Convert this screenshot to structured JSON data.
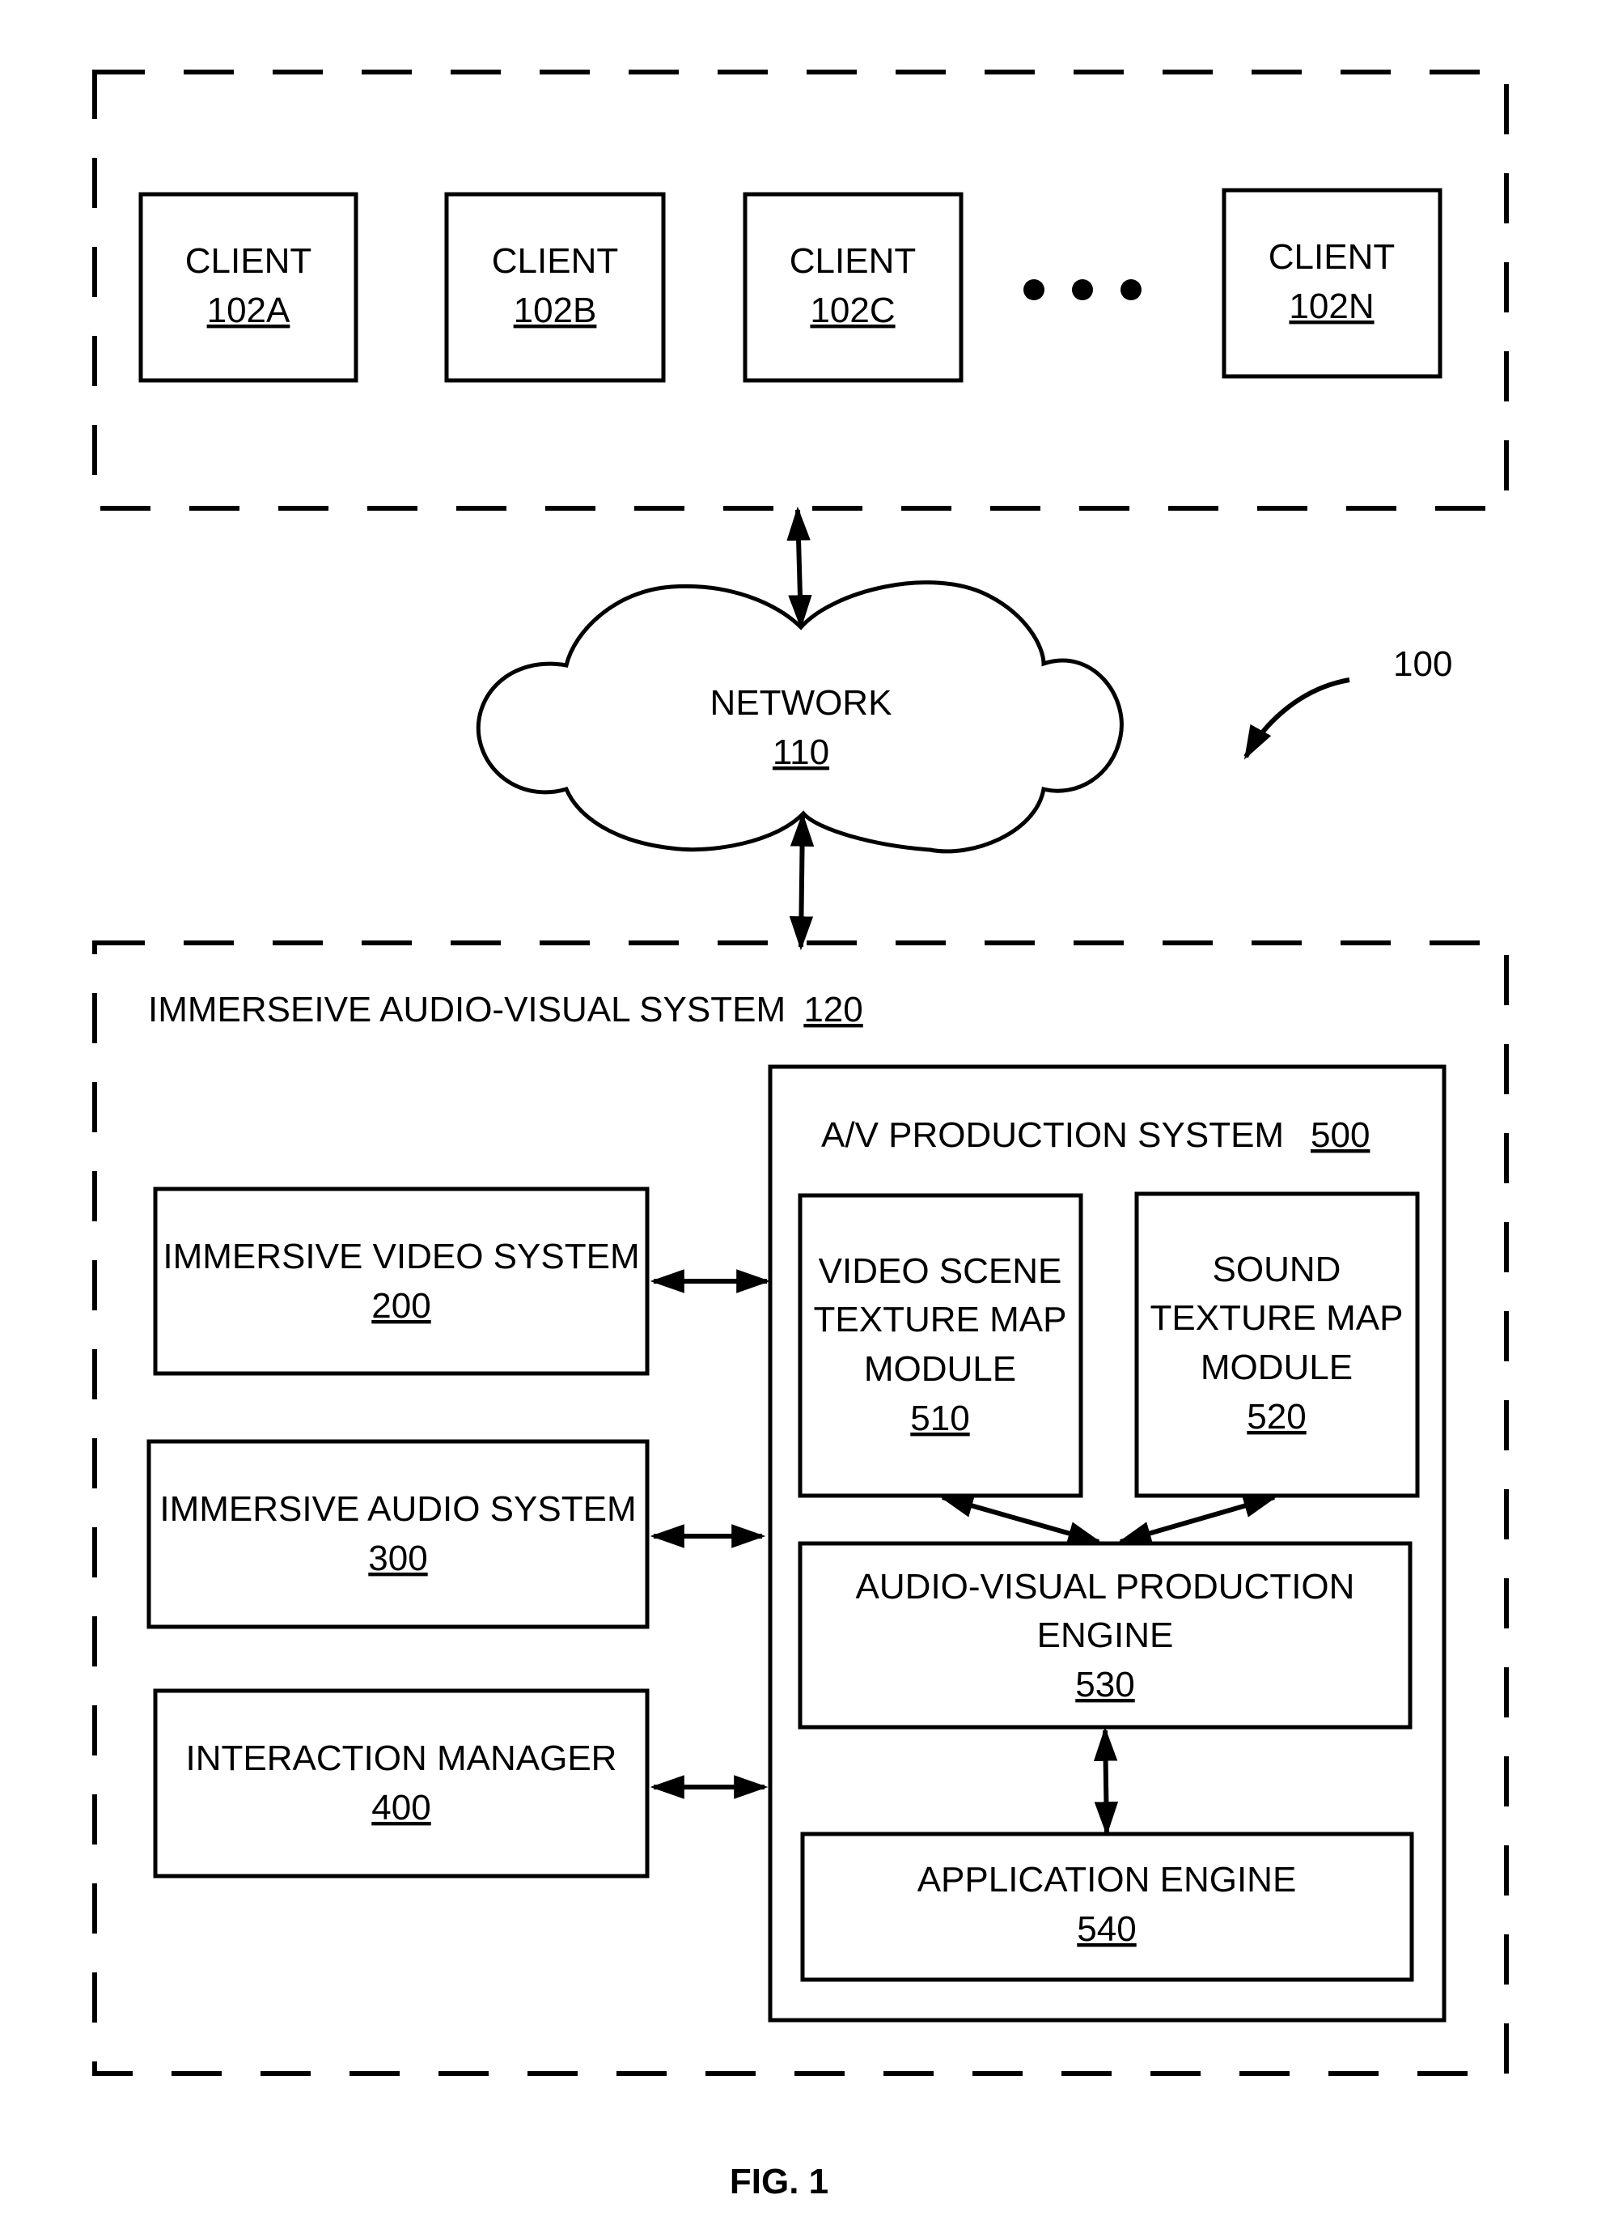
{
  "figure": {
    "caption": "FIG. 1",
    "system_ref": "100"
  },
  "client_group": {
    "clients": [
      {
        "label": "CLIENT",
        "ref": "102A"
      },
      {
        "label": "CLIENT",
        "ref": "102B"
      },
      {
        "label": "CLIENT",
        "ref": "102C"
      },
      {
        "label": "CLIENT",
        "ref": "102N"
      }
    ],
    "ellipsis": "•••"
  },
  "network": {
    "label": "NETWORK",
    "ref": "110"
  },
  "av_system": {
    "title": "IMMERSEIVE AUDIO-VISUAL SYSTEM",
    "ref": "120",
    "left_components": [
      {
        "label": "IMMERSIVE VIDEO SYSTEM",
        "ref": "200"
      },
      {
        "label": "IMMERSIVE AUDIO SYSTEM",
        "ref": "300"
      },
      {
        "label": "INTERACTION MANAGER",
        "ref": "400"
      }
    ],
    "production_system": {
      "title": "A/V PRODUCTION SYSTEM",
      "ref": "500",
      "video_module": {
        "lines": [
          "VIDEO SCENE",
          "TEXTURE MAP",
          "MODULE"
        ],
        "ref": "510"
      },
      "sound_module": {
        "lines": [
          "SOUND",
          "TEXTURE MAP",
          "MODULE"
        ],
        "ref": "520"
      },
      "production_engine": {
        "lines": [
          "AUDIO-VISUAL PRODUCTION",
          "ENGINE"
        ],
        "ref": "530"
      },
      "application_engine": {
        "lines": [
          "APPLICATION ENGINE"
        ],
        "ref": "540"
      }
    }
  }
}
